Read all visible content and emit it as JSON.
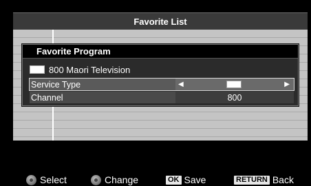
{
  "window": {
    "title": "Favorite List"
  },
  "dialog": {
    "title": "Favorite Program",
    "program_name": "800 Maori Television",
    "fields": {
      "service_type": {
        "label": "Service Type",
        "left_arrow": "◀",
        "right_arrow": "▶"
      },
      "channel": {
        "label": "Channel",
        "value": "800"
      }
    }
  },
  "footer": {
    "select": "Select",
    "change": "Change",
    "save_key": "OK",
    "save": "Save",
    "back_key": "RETURN",
    "back": "Back"
  },
  "colors": {
    "background": "#000000",
    "title_bar": "#3a3a3a",
    "list_area": "#b9b9b9",
    "dialog": "#2b2b2b",
    "highlight_outline": "#d8d8d8"
  }
}
